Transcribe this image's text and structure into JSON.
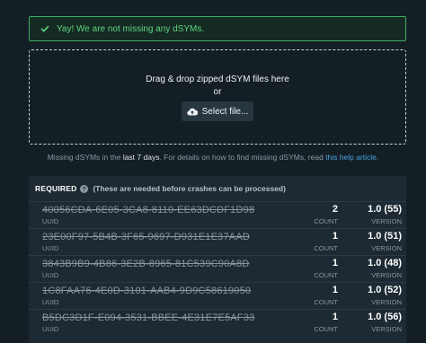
{
  "success": {
    "message": "Yay! We are not missing any dSYMs."
  },
  "dropzone": {
    "instruction": "Drag & drop zipped dSYM files here",
    "or_text": "or",
    "select_label": "Select file..."
  },
  "help": {
    "prefix": "Missing dSYMs in the ",
    "period": "last 7 days",
    "middle": ". For details on how to find missing dSYMs, read ",
    "link": "this help article",
    "suffix": "."
  },
  "required": {
    "title": "REQUIRED",
    "note": "(These are needed before crashes can be processed)",
    "rows": [
      {
        "uuid": "40056CDA-6E05-3CA8-8110-EE63DCDF1D98",
        "uuid_label": "UUID",
        "count": "2",
        "count_label": "COUNT",
        "version": "1.0 (55)",
        "version_label": "VERSION"
      },
      {
        "uuid": "23E00F97-5B4B-3F65-9697-D931E1E37AAD",
        "uuid_label": "UUID",
        "count": "1",
        "count_label": "COUNT",
        "version": "1.0 (51)",
        "version_label": "VERSION"
      },
      {
        "uuid": "3843B9B9-4B86-3E2B-8965-81C539C90A8D",
        "uuid_label": "UUID",
        "count": "1",
        "count_label": "COUNT",
        "version": "1.0 (48)",
        "version_label": "VERSION"
      },
      {
        "uuid": "1C8FAA76-4E0D-3101-AAB4-9D9C58619050",
        "uuid_label": "UUID",
        "count": "1",
        "count_label": "COUNT",
        "version": "1.0 (52)",
        "version_label": "VERSION"
      },
      {
        "uuid": "B5DC3D1F-E094-3531-BBEE-4E31E7E5AF33",
        "uuid_label": "UUID",
        "count": "1",
        "count_label": "COUNT",
        "version": "1.0 (56)",
        "version_label": "VERSION"
      }
    ]
  },
  "colors": {
    "background": "#141e25",
    "success": "#5bd57f",
    "link": "#4aa3df",
    "panel": "#1d2a33"
  }
}
